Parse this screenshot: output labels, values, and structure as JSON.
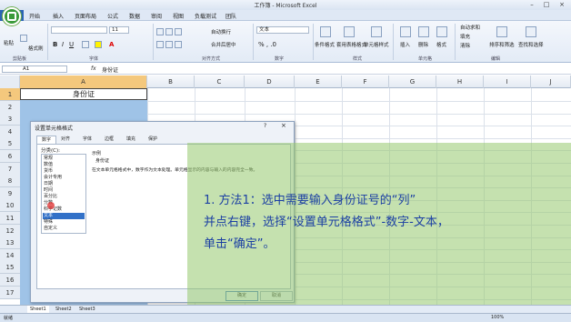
{
  "window": {
    "title": "工作簿 - Microsoft Excel"
  },
  "ribbon_tabs": [
    "开始",
    "插入",
    "页面布局",
    "公式",
    "数据",
    "审阅",
    "视图",
    "负载测试",
    "团队"
  ],
  "file_tab": "文件",
  "ribbon": {
    "clipboard": {
      "paste": "粘贴",
      "format_painter": "格式刷",
      "label": "剪贴板"
    },
    "font": {
      "size": "11",
      "label": "字体"
    },
    "alignment": {
      "wrap": "自动换行",
      "merge": "合并后居中",
      "label": "对齐方式"
    },
    "number": {
      "format": "文本",
      "label": "数字"
    },
    "styles": {
      "conditional": "条件格式",
      "table": "套用表格格式",
      "cell": "单元格样式",
      "label": "样式"
    },
    "cells": {
      "insert": "插入",
      "delete": "删除",
      "format": "格式",
      "label": "单元格"
    },
    "editing": {
      "autosum": "自动求和",
      "fill": "填充",
      "clear": "清除",
      "sort": "排序和筛选",
      "find": "查找和选择",
      "label": "编辑"
    }
  },
  "formula_bar": {
    "name_box": "A1",
    "fx": "fx",
    "content": "身份证"
  },
  "columns": [
    "A",
    "B",
    "C",
    "D",
    "E",
    "F",
    "G",
    "H",
    "I",
    "J"
  ],
  "rows": [
    "1",
    "2",
    "3",
    "4",
    "5",
    "6",
    "7",
    "8",
    "9",
    "10",
    "11",
    "12",
    "13",
    "14",
    "15",
    "16",
    "17"
  ],
  "cell_a1": "身份证",
  "dialog": {
    "title": "设置单元格格式",
    "help": "?",
    "close": "×",
    "tabs": [
      "数字",
      "对齐",
      "字体",
      "边框",
      "填充",
      "保护"
    ],
    "category_label": "分类(C):",
    "categories": [
      "常规",
      "数值",
      "货币",
      "会计专用",
      "日期",
      "时间",
      "百分比",
      "分数",
      "科学记数",
      "文本",
      "特殊",
      "自定义"
    ],
    "selected_category": "文本",
    "sample_label": "示例",
    "sample_value": "身份证",
    "description": "在文本单元格格式中，数字作为文本处理。单元格显示的内容与输入的内容完全一致。",
    "ok": "确定",
    "cancel": "取消"
  },
  "overlay": {
    "line1": "1. 方法1：选中需要输入身份证号的“列”",
    "line2": "并点右键，选择“设置单元格格式”-数字-文本，",
    "line3": "单击“确定”。"
  },
  "sheets": [
    "Sheet1",
    "Sheet2",
    "Sheet3"
  ],
  "status": {
    "ready": "就绪",
    "zoom": "100%"
  },
  "colors": {
    "accent": "#2b64b5",
    "selection": "#9fc3e7",
    "overlay": "#96c86e",
    "overlay_text": "#1b3fa3"
  }
}
